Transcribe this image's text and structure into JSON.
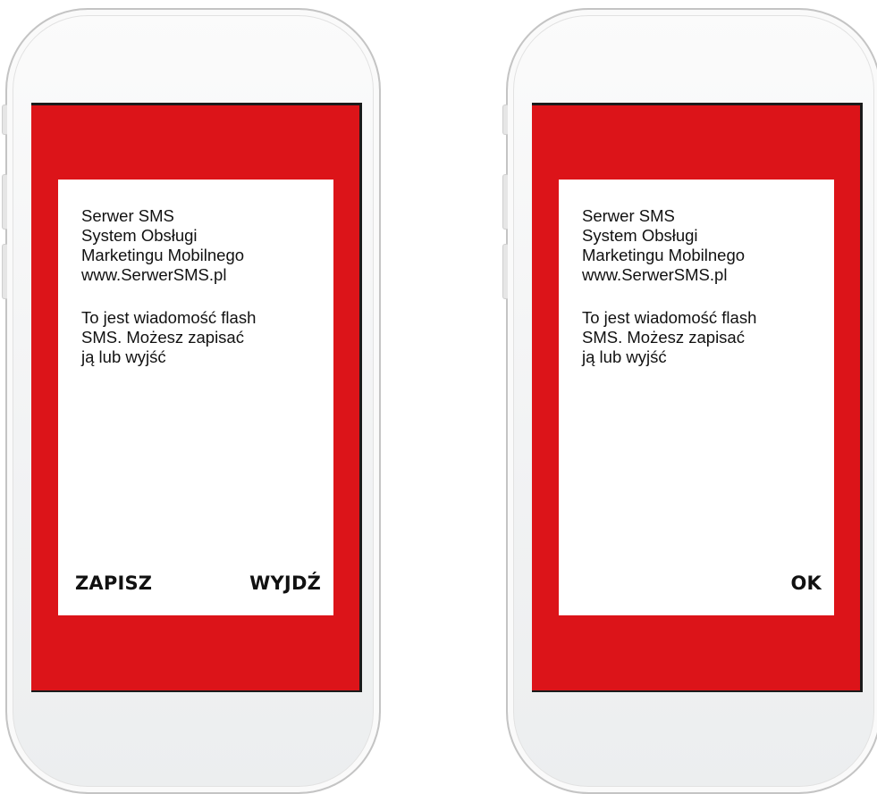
{
  "phones": [
    {
      "message_lines": [
        "Serwer SMS",
        "System Obsługi",
        "Marketingu Mobilnego",
        "www.SerwerSMS.pl",
        "",
        "To jest wiadomość flash",
        "SMS. Możesz zapisać",
        "ją lub wyjść"
      ],
      "buttons": {
        "save": "ZAPISZ",
        "exit": "WYJDŹ"
      }
    },
    {
      "message_lines": [
        "Serwer SMS",
        "System Obsługi",
        "Marketingu Mobilnego",
        "www.SerwerSMS.pl",
        "",
        "To jest wiadomość flash",
        "SMS. Możesz zapisać",
        "ją lub wyjść"
      ],
      "buttons": {
        "ok": "OK"
      }
    }
  ],
  "colors": {
    "screen_background": "#dc1419",
    "dialog_background": "#ffffff",
    "text": "#111111"
  }
}
